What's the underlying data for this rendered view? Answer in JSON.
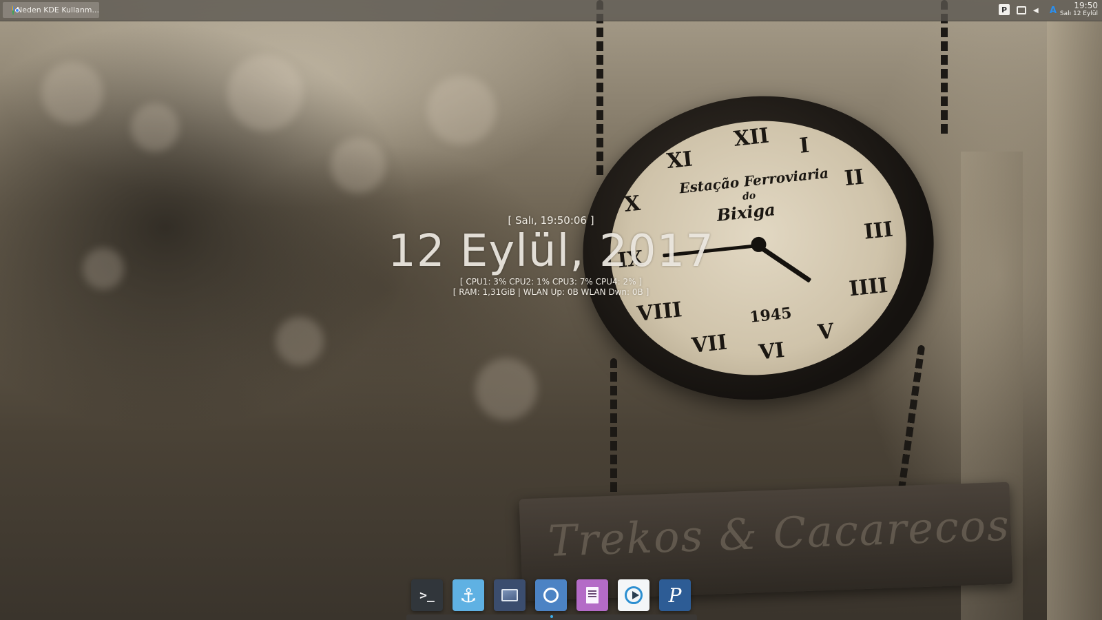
{
  "taskbar": {
    "window_title": "Neden KDE Kullanm...",
    "window_icon": "chrome-icon"
  },
  "tray": {
    "icons": [
      "plasma-p-icon",
      "window-icon",
      "volume-icon",
      "network-a-icon"
    ],
    "p_glyph": "P",
    "vol_glyph": "◀",
    "a_glyph": "A",
    "clock_time": "19:50",
    "clock_date": "Salı 12 Eylül"
  },
  "conky": {
    "time_line": "[ Salı, 19:50:06 ]",
    "date_line": "12 Eylül, 2017",
    "cpu_line": "[ CPU1: 3% CPU2: 1% CPU3: 7% CPU4: 2% ]",
    "net_line": "[ RAM: 1,31GiB | WLAN Up: 0B   WLAN Dwn: 0B   ]"
  },
  "wallpaper": {
    "clock_numerals": [
      "XII",
      "I",
      "II",
      "III",
      "IIII",
      "V",
      "VI",
      "VII",
      "VIII",
      "IX",
      "X",
      "XI"
    ],
    "face_title": "Estação Ferroviaria",
    "face_sub": "do",
    "face_name": "Bixiga",
    "face_year": "1945",
    "sign_text": "Trekos & Cacarecos"
  },
  "dock": {
    "apps": [
      {
        "name": "terminal-icon",
        "glyph": ">_"
      },
      {
        "name": "anchor-icon",
        "glyph": "⚓"
      },
      {
        "name": "image-viewer-icon",
        "glyph": ""
      },
      {
        "name": "chromium-icon",
        "glyph": ""
      },
      {
        "name": "text-editor-icon",
        "glyph": ""
      },
      {
        "name": "media-player-icon",
        "glyph": ""
      },
      {
        "name": "p-app-icon",
        "glyph": "P"
      }
    ]
  },
  "colors": {
    "accent": "#3daee9",
    "panel": "#5a5650",
    "text": "#f0ece4"
  }
}
